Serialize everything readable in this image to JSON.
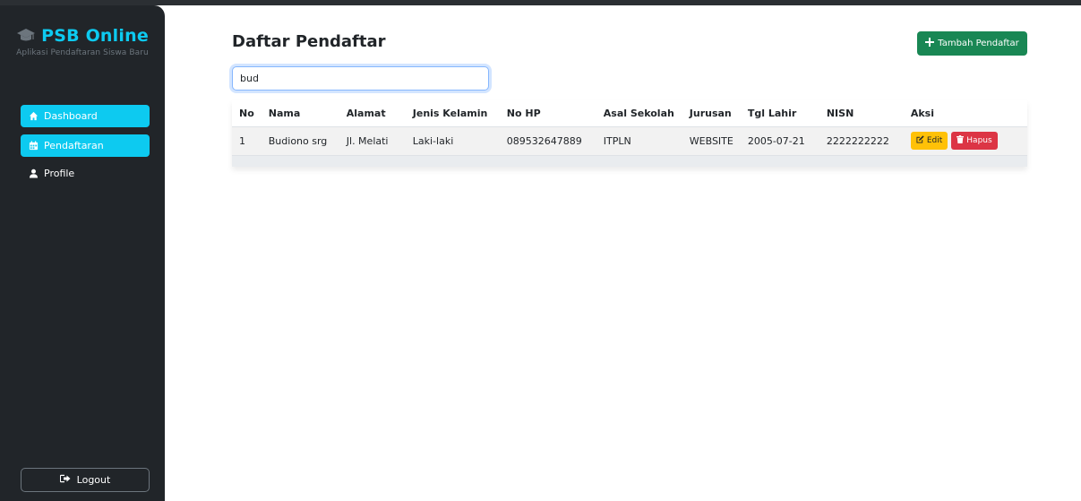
{
  "brand": {
    "title": "PSB Online",
    "subtitle": "Aplikasi Pendaftaran Siswa Baru",
    "icon": "graduation-cap-icon"
  },
  "sidebar": {
    "items": [
      {
        "label": "Dashboard",
        "icon": "home-icon",
        "active": true
      },
      {
        "label": "Pendaftaran",
        "icon": "calendar-icon",
        "active": true
      },
      {
        "label": "Profile",
        "icon": "user-icon",
        "active": false
      }
    ],
    "logout_label": "Logout"
  },
  "main": {
    "title": "Daftar Pendaftar",
    "add_button_label": "Tambah Pendaftar",
    "search_value": "bud"
  },
  "table": {
    "headers": [
      "No",
      "Nama",
      "Alamat",
      "Jenis Kelamin",
      "No HP",
      "Asal Sekolah",
      "Jurusan",
      "Tgl Lahir",
      "NISN",
      "Aksi"
    ],
    "rows": [
      {
        "no": "1",
        "nama": "Budiono srg",
        "alamat": "Jl. Melati",
        "jenis_kelamin": "Laki-laki",
        "no_hp": "089532647889",
        "asal_sekolah": "ITPLN",
        "jurusan": "WEBSITE",
        "tgl_lahir": "2005-07-21",
        "nisn": "2222222222",
        "edit_label": "Edit",
        "hapus_label": "Hapus"
      }
    ]
  },
  "colors": {
    "sidebar_bg": "#212529",
    "accent": "#0dcaf0",
    "success": "#198754",
    "warning": "#ffc107",
    "danger": "#dc3545"
  }
}
